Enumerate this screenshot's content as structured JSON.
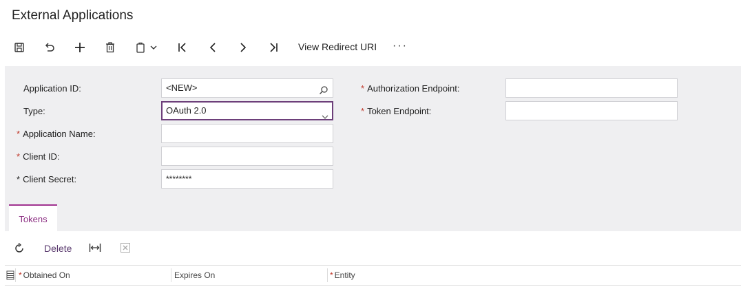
{
  "page": {
    "title": "External Applications"
  },
  "toolbar": {
    "view_redirect_label": "View Redirect URI",
    "more_label": "···"
  },
  "form": {
    "application_id": {
      "label": "Application ID:",
      "value": "<NEW>"
    },
    "type": {
      "label": "Type:",
      "value": "OAuth 2.0"
    },
    "application_name": {
      "label": "Application Name:",
      "required_marker": "*",
      "value": ""
    },
    "client_id": {
      "label": "Client ID:",
      "required_marker": "*",
      "value": ""
    },
    "client_secret": {
      "label": "Client Secret:",
      "required_marker": "*",
      "value": "********"
    },
    "authorization_endpoint": {
      "label": "Authorization Endpoint:",
      "required_marker": "*",
      "value": ""
    },
    "token_endpoint": {
      "label": "Token Endpoint:",
      "required_marker": "*",
      "value": ""
    }
  },
  "tabs": [
    {
      "label": "Tokens",
      "active": true
    }
  ],
  "grid_toolbar": {
    "delete_label": "Delete"
  },
  "grid": {
    "columns": [
      {
        "label": "Obtained On",
        "required_marker": "*"
      },
      {
        "label": "Expires On",
        "required_marker": ""
      },
      {
        "label": "Entity",
        "required_marker": "*"
      }
    ]
  },
  "colors": {
    "accent": "#a0328f",
    "required": "#c0392b",
    "panel": "#efeff1"
  }
}
